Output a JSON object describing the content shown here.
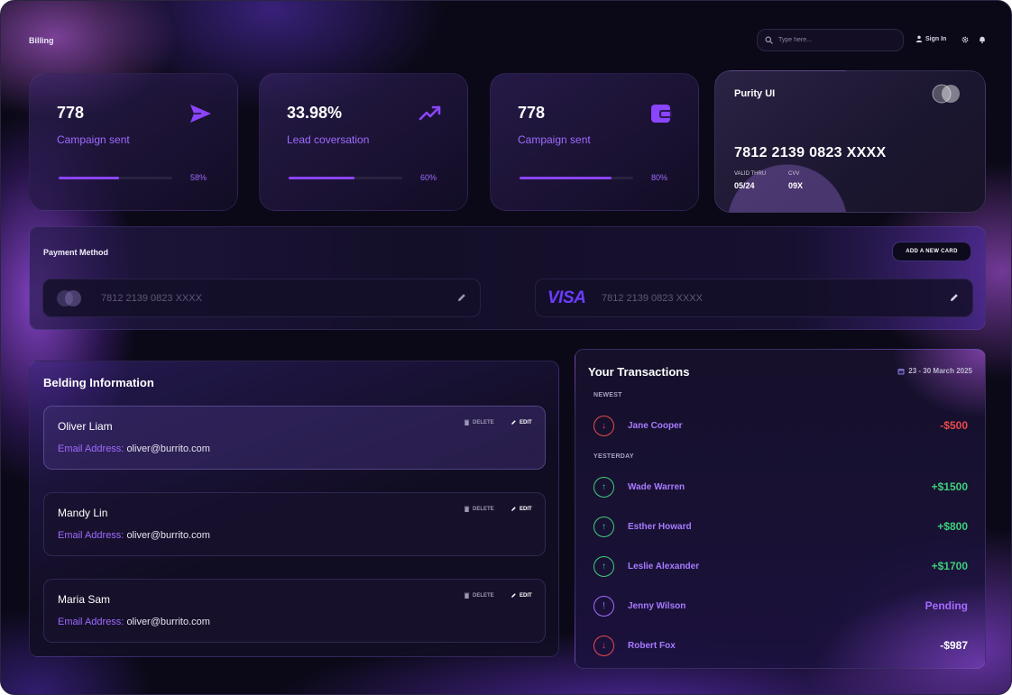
{
  "header": {
    "page_title": "Billing",
    "search_placeholder": "Type here...",
    "sign_in_label": "Sign In",
    "icons": [
      "search-icon",
      "user-icon",
      "gear-icon",
      "bell-icon"
    ]
  },
  "stats": [
    {
      "value": "778",
      "label": "Campaign sent",
      "percent_label": "58%",
      "progress": 0.53,
      "icon": "send-icon"
    },
    {
      "value": "33.98%",
      "label": "Lead coversation",
      "percent_label": "60%",
      "progress": 0.58,
      "icon": "trending-up-icon"
    },
    {
      "value": "778",
      "label": "Campaign sent",
      "percent_label": "80%",
      "progress": 0.81,
      "icon": "wallet-icon"
    }
  ],
  "credit_card": {
    "brand": "Purity UI",
    "number": "7812 2139 0823 XXXX",
    "valid_thru_label": "VALID THRU",
    "valid_thru": "05/24",
    "cvv_label": "CVV",
    "cvv": "09X"
  },
  "payment_method": {
    "title": "Payment Method",
    "add_card_label": "ADD A NEW CARD",
    "cards": [
      {
        "icon": "mastercard-icon",
        "number": "7812 2139 0823 XXXX"
      },
      {
        "icon": "visa-icon",
        "logo_text": "VISA",
        "number": "7812 2139 0823 XXXX"
      }
    ]
  },
  "billing_info": {
    "title": "Belding Information",
    "delete_label": "DELETE",
    "edit_label": "EDIT",
    "email_label": "Email Address:",
    "items": [
      {
        "name": "Oliver Liam",
        "email": "oliver@burrito.com"
      },
      {
        "name": "Mandy Lin",
        "email": "oliver@burrito.com"
      },
      {
        "name": "Maria Sam",
        "email": "oliver@burrito.com"
      }
    ]
  },
  "transactions": {
    "title": "Your Transactions",
    "date_range": "23 - 30 March 2025",
    "sections": {
      "newest": "NEWEST",
      "yesterday": "YESTERDAY"
    },
    "items": [
      {
        "name": "Jane Cooper",
        "amount": "-$500",
        "type": "debit"
      },
      {
        "name": "Wade Warren",
        "amount": "+$1500",
        "type": "credit"
      },
      {
        "name": "Esther Howard",
        "amount": "+$800",
        "type": "credit"
      },
      {
        "name": "Leslie Alexander",
        "amount": "+$1700",
        "type": "credit"
      },
      {
        "name": "Jenny Wilson",
        "amount": "Pending",
        "type": "pending"
      },
      {
        "name": "Robert Fox",
        "amount": "-$987",
        "type": "debit"
      }
    ],
    "colors": {
      "debit": "#e84a4a",
      "credit": "#3ecf7a",
      "pending": "#a46bff"
    }
  },
  "colors": {
    "accent": "#8b45ff",
    "background": "#0b0917"
  }
}
